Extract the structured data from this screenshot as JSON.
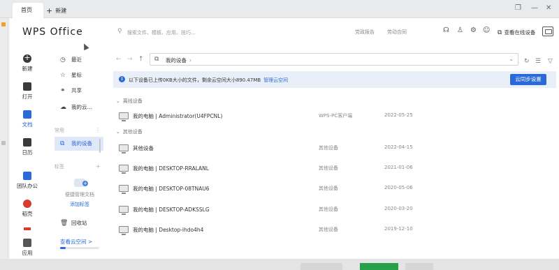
{
  "titlebar": {
    "home_tab": "首页",
    "new_tab": "新建"
  },
  "header": {
    "logo": "WPS Office",
    "search_placeholder": "搜索文件、模板、应用、技巧...",
    "link_party": "党政报告",
    "link_labor": "劳动合同",
    "online_devices": "查看在线设备"
  },
  "left_nav": {
    "items": [
      {
        "label": "新建",
        "icon": "plus-circle-icon"
      },
      {
        "label": "打开",
        "icon": "folder-icon"
      },
      {
        "label": "文档",
        "icon": "document-icon"
      },
      {
        "label": "日历",
        "icon": "calendar-icon"
      },
      {
        "label": "团队办公",
        "icon": "team-icon"
      },
      {
        "label": "稻壳",
        "icon": "docer-icon"
      },
      {
        "label": "应用",
        "icon": "apps-icon"
      }
    ]
  },
  "sub_nav": {
    "items": [
      {
        "label": "最近",
        "icon": "clock-icon"
      },
      {
        "label": "星标",
        "icon": "star-icon"
      },
      {
        "label": "共享",
        "icon": "share-icon"
      },
      {
        "label": "我的云...",
        "icon": "cloud-icon"
      }
    ],
    "common_header": "常用",
    "my_devices": "我的设备",
    "tags_header": "标签",
    "manage_docs_text": "便捷管理文档",
    "add_tag": "添加标签",
    "recycle": "回收站",
    "view_space": "查看云空间 >",
    "space_used_fraction": 0.15
  },
  "path": {
    "root": "我的设备"
  },
  "banner": {
    "message": "以下设备已上传0KB大小的文件，剩余云空间大小890.47MB",
    "manage_link": "管理云空间",
    "sync_button": "云同步设置"
  },
  "offline_section": {
    "title": "离线设备",
    "rows": [
      {
        "name": "我的电脑 | Administrator(U4FPCNL)",
        "type": "WPS-PC客户端",
        "date": "2022-05-25"
      }
    ]
  },
  "other_section": {
    "title": "其他设备",
    "rows": [
      {
        "name": "其他设备",
        "type": "其他设备",
        "date": "2022-04-15"
      },
      {
        "name": "我的电脑 | DESKTOP-RRALANL",
        "type": "其他设备",
        "date": "2021-01-06"
      },
      {
        "name": "我的电脑 | DESKTOP-08TNAU6",
        "type": "其他设备",
        "date": "2020-05-06"
      },
      {
        "name": "我的电脑 | DESKTOP-ADKSSLG",
        "type": "其他设备",
        "date": "2020-03-20"
      },
      {
        "name": "我的电脑 | Desktop-ihdo4h4",
        "type": "其他设备",
        "date": "2019-12-10"
      }
    ]
  },
  "colors": {
    "accent": "#2a6ad8",
    "banner_bg": "#e8eff9",
    "active_nav_bg": "#dfe8f8"
  }
}
